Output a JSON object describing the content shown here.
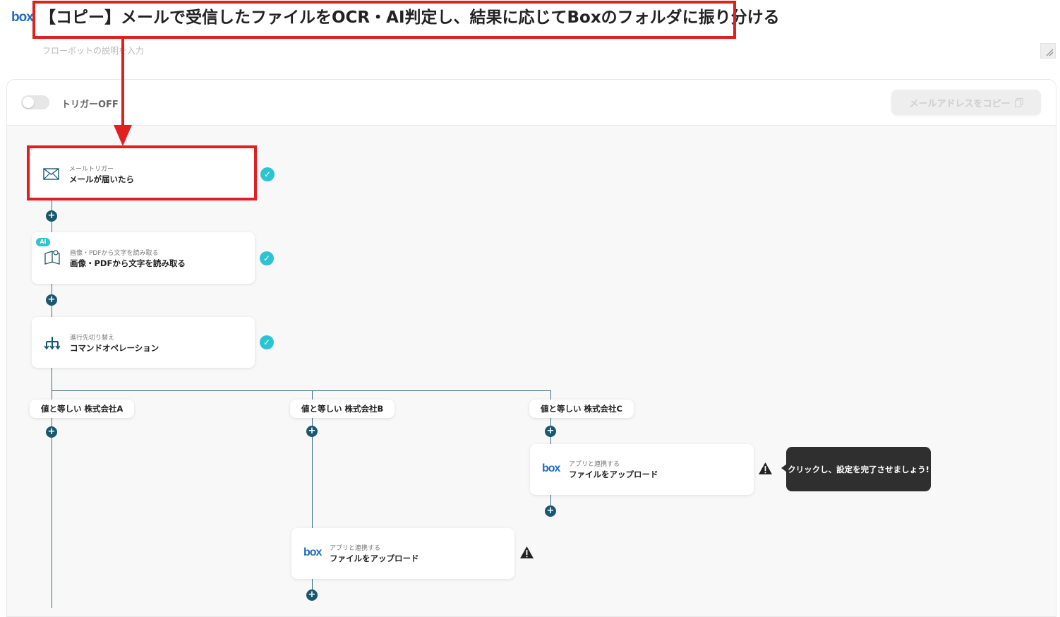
{
  "header": {
    "logo_text": "box",
    "title": "【コピー】メールで受信したファイルをOCR・AI判定し、結果に応じてBoxのフォルダに振り分ける",
    "description_placeholder": "フローボットの説明を入力"
  },
  "toolbar": {
    "trigger_label": "トリガーOFF",
    "trigger_on": false,
    "copy_email_label": "メールアドレスをコピー"
  },
  "flow": {
    "steps": [
      {
        "category": "メールトリガー",
        "title": "メールが届いたら",
        "icon": "mail-icon",
        "status": "complete"
      },
      {
        "category": "画像・PDFから文字を読み取る",
        "title": "画像・PDFから文字を読み取る",
        "icon": "ocr-book-icon",
        "badge": "AI",
        "status": "complete"
      },
      {
        "category": "進行先切り替え",
        "title": "コマンドオペレーション",
        "icon": "branch-icon",
        "status": "complete"
      }
    ],
    "branches": [
      {
        "label": "値と等しい 株式会社A"
      },
      {
        "label": "値と等しい 株式会社B",
        "step": {
          "category": "アプリと連携する",
          "title": "ファイルをアップロード",
          "icon": "box-logo-icon",
          "status": "warning"
        }
      },
      {
        "label": "値と等しい 株式会社C",
        "step": {
          "category": "アプリと連携する",
          "title": "ファイルをアップロード",
          "icon": "box-logo-icon",
          "status": "warning"
        }
      }
    ],
    "tooltip": "クリックし、設定を完了させましょう!"
  },
  "colors": {
    "accent": "#2cc4d3",
    "connector": "#1a5870",
    "highlight": "#e02020",
    "box_brand": "#1b6dc1"
  }
}
